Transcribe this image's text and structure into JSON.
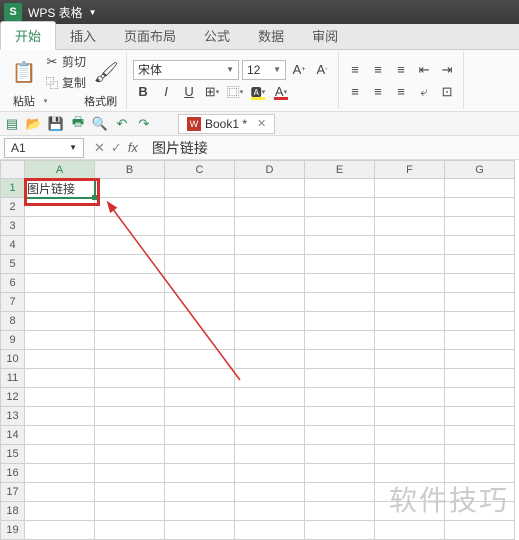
{
  "app": {
    "logo": "S",
    "name": "WPS 表格"
  },
  "tabs": [
    "开始",
    "插入",
    "页面布局",
    "公式",
    "数据",
    "审阅"
  ],
  "active_tab": 0,
  "ribbon": {
    "paste": "粘贴",
    "cut": "剪切",
    "copy": "复制",
    "fmtpaint": "格式刷",
    "font_name": "宋体",
    "font_size": "12",
    "bold": "B",
    "italic": "I",
    "underline": "U"
  },
  "doc_tab": "Book1 *",
  "namebox": "A1",
  "formula_content": "图片链接",
  "columns": [
    "A",
    "B",
    "C",
    "D",
    "E",
    "F",
    "G"
  ],
  "rows": [
    "1",
    "2",
    "3",
    "4",
    "5",
    "6",
    "7",
    "8",
    "9",
    "10",
    "11",
    "12",
    "13",
    "14",
    "15",
    "16",
    "17",
    "18",
    "19"
  ],
  "cell_A1": "图片链接",
  "watermark": "软件技巧"
}
